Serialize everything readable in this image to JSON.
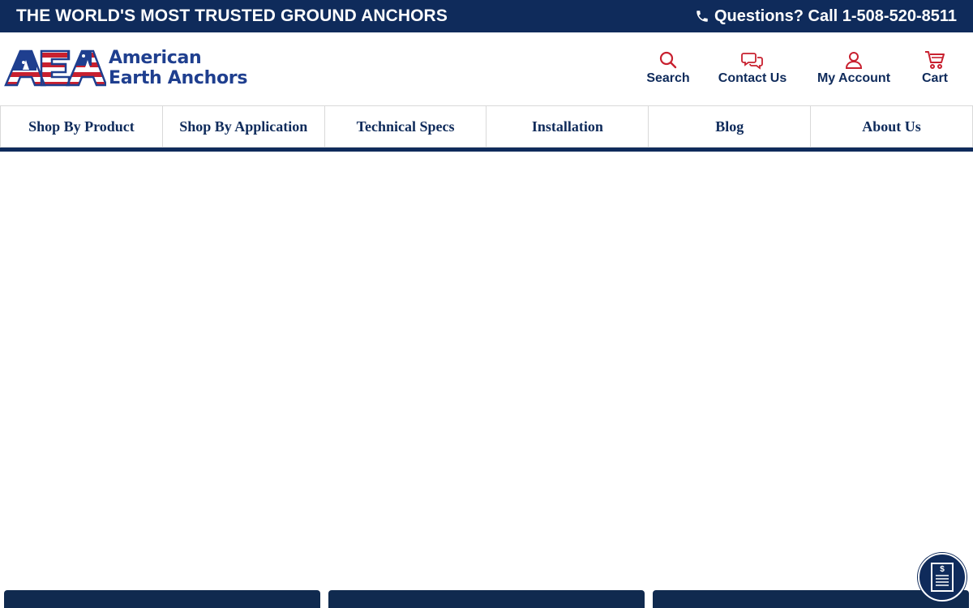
{
  "topbar": {
    "tagline": "THE WORLD'S MOST TRUSTED GROUND ANCHORS",
    "phone_text": "Questions? Call 1-508-520-8511",
    "phone_icon": "phone-icon"
  },
  "logo": {
    "mark_text": "AEA",
    "line1": "American",
    "line2": "Earth Anchors"
  },
  "utility_nav": [
    {
      "label": "Search",
      "icon": "search-icon"
    },
    {
      "label": "Contact Us",
      "icon": "chat-icon"
    },
    {
      "label": "My Account",
      "icon": "user-icon"
    },
    {
      "label": "Cart",
      "icon": "cart-icon"
    }
  ],
  "main_nav": [
    {
      "label": "Shop By Product"
    },
    {
      "label": "Shop By Application"
    },
    {
      "label": "Technical Specs"
    },
    {
      "label": "Installation"
    },
    {
      "label": "Blog"
    },
    {
      "label": "About Us"
    }
  ],
  "quote_button": {
    "icon": "price-quote-icon",
    "symbol": "$"
  },
  "colors": {
    "navy": "#0f2b5b",
    "logo_blue": "#1f3f8f",
    "flag_red": "#c8202f",
    "white": "#ffffff"
  }
}
